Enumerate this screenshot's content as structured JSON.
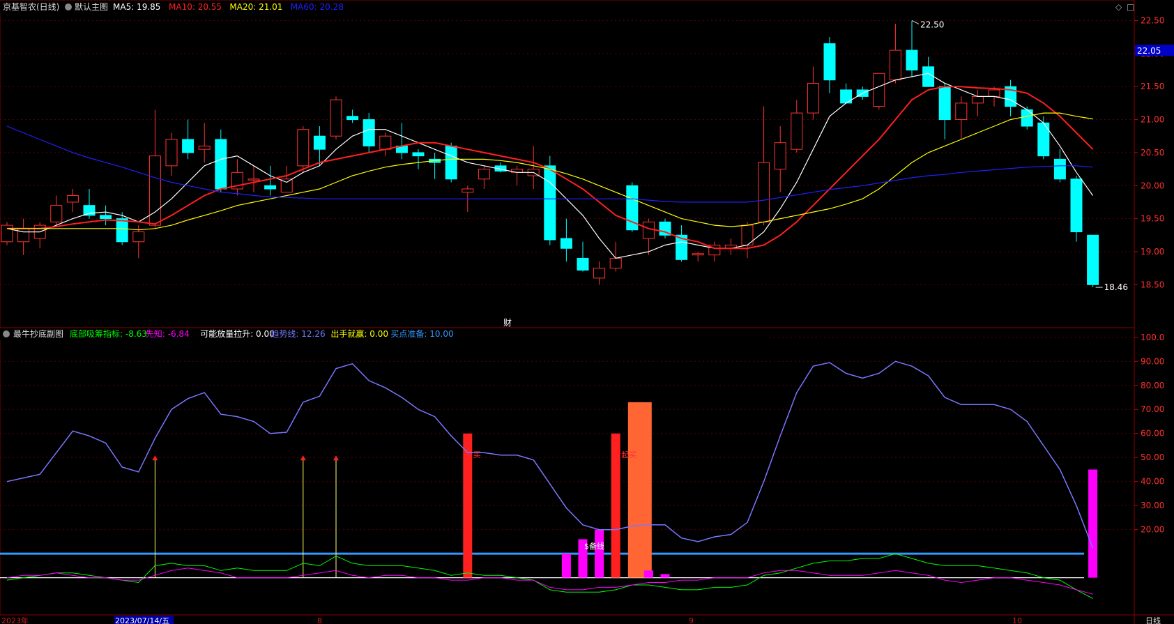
{
  "main_panel": {
    "stock_name": "京基智农",
    "period": "(日线)",
    "template_name": "默认主图",
    "ma_items": [
      {
        "label": "MA5: 19.85",
        "color": "#ffffff"
      },
      {
        "label": "MA10: 20.55",
        "color": "#ff2020"
      },
      {
        "label": "MA20: 21.01",
        "color": "#ffff00"
      },
      {
        "label": "MA60: 20.28",
        "color": "#2020ff"
      }
    ],
    "y_ticks": [
      "22.50",
      "22.00",
      "21.50",
      "21.00",
      "20.50",
      "20.00",
      "19.50",
      "19.00",
      "18.50"
    ],
    "last_price_tag": "22.05",
    "high_marker": "22.50",
    "low_marker": "18.46",
    "finance_marker": "财"
  },
  "sub_panel": {
    "title": "最牛抄底副图",
    "items": [
      {
        "label": "底部吸筹指标: -8.63",
        "color": "#00ff00"
      },
      {
        "label": "先知: -6.84",
        "color": "#ff00ff"
      },
      {
        "label": "可能放量拉升: 0.00",
        "color": "#ffffff"
      },
      {
        "label": "趋势线: 12.26",
        "color": "#7777ff"
      },
      {
        "label": "出手就赢: 0.00",
        "color": "#ffff00"
      },
      {
        "label": "买点准备: 10.00",
        "color": "#3399ff"
      }
    ],
    "y_ticks": [
      "100.0",
      "90.00",
      "80.00",
      "70.00",
      "60.00",
      "50.00",
      "40.00",
      "30.00",
      "20.00"
    ],
    "annotations": [
      "买",
      "起买",
      "$备线"
    ]
  },
  "x_axis": {
    "labels": [
      "2023年",
      "2023/07/14/五",
      "8",
      "9",
      "10"
    ],
    "period_label": "日线"
  },
  "chart_data": [
    {
      "type": "candlestick",
      "title": "京基智农 (日线)",
      "ylim": [
        18.25,
        22.6
      ],
      "candles": [
        {
          "o": 19.15,
          "h": 19.45,
          "l": 19.1,
          "c": 19.4
        },
        {
          "o": 19.15,
          "h": 19.5,
          "l": 18.95,
          "c": 19.35
        },
        {
          "o": 19.2,
          "h": 19.45,
          "l": 19.05,
          "c": 19.4
        },
        {
          "o": 19.45,
          "h": 19.85,
          "l": 19.4,
          "c": 19.7
        },
        {
          "o": 19.75,
          "h": 19.95,
          "l": 19.6,
          "c": 19.85
        },
        {
          "o": 19.7,
          "h": 19.95,
          "l": 19.5,
          "c": 19.55
        },
        {
          "o": 19.55,
          "h": 19.7,
          "l": 19.4,
          "c": 19.5
        },
        {
          "o": 19.5,
          "h": 19.6,
          "l": 19.1,
          "c": 19.15
        },
        {
          "o": 19.15,
          "h": 19.4,
          "l": 18.9,
          "c": 19.3
        },
        {
          "o": 19.4,
          "h": 21.15,
          "l": 19.35,
          "c": 20.45
        },
        {
          "o": 20.3,
          "h": 20.8,
          "l": 20.15,
          "c": 20.7
        },
        {
          "o": 20.7,
          "h": 21.0,
          "l": 20.4,
          "c": 20.5
        },
        {
          "o": 20.55,
          "h": 20.95,
          "l": 20.35,
          "c": 20.6
        },
        {
          "o": 20.7,
          "h": 20.85,
          "l": 19.9,
          "c": 19.95
        },
        {
          "o": 19.95,
          "h": 20.4,
          "l": 19.85,
          "c": 20.2
        },
        {
          "o": 20.1,
          "h": 20.3,
          "l": 19.9,
          "c": 20.1
        },
        {
          "o": 20.0,
          "h": 20.3,
          "l": 19.85,
          "c": 19.95
        },
        {
          "o": 19.9,
          "h": 20.3,
          "l": 19.9,
          "c": 20.1
        },
        {
          "o": 20.3,
          "h": 20.9,
          "l": 20.2,
          "c": 20.85
        },
        {
          "o": 20.75,
          "h": 20.9,
          "l": 20.3,
          "c": 20.55
        },
        {
          "o": 20.75,
          "h": 21.35,
          "l": 20.7,
          "c": 21.3
        },
        {
          "o": 21.05,
          "h": 21.15,
          "l": 20.95,
          "c": 21.0
        },
        {
          "o": 21.0,
          "h": 21.1,
          "l": 20.5,
          "c": 20.6
        },
        {
          "o": 20.55,
          "h": 20.8,
          "l": 20.45,
          "c": 20.75
        },
        {
          "o": 20.6,
          "h": 20.95,
          "l": 20.4,
          "c": 20.5
        },
        {
          "o": 20.5,
          "h": 20.55,
          "l": 20.25,
          "c": 20.45
        },
        {
          "o": 20.4,
          "h": 20.5,
          "l": 20.1,
          "c": 20.35
        },
        {
          "o": 20.6,
          "h": 20.65,
          "l": 20.05,
          "c": 20.1
        },
        {
          "o": 19.9,
          "h": 20.0,
          "l": 19.6,
          "c": 19.95
        },
        {
          "o": 20.1,
          "h": 20.3,
          "l": 19.95,
          "c": 20.25
        },
        {
          "o": 20.3,
          "h": 20.35,
          "l": 20.2,
          "c": 20.22
        },
        {
          "o": 20.2,
          "h": 20.3,
          "l": 20.0,
          "c": 20.25
        },
        {
          "o": 20.15,
          "h": 20.6,
          "l": 19.95,
          "c": 20.25
        },
        {
          "o": 20.3,
          "h": 20.45,
          "l": 19.1,
          "c": 19.18
        },
        {
          "o": 19.2,
          "h": 19.5,
          "l": 18.85,
          "c": 19.05
        },
        {
          "o": 18.9,
          "h": 19.15,
          "l": 18.7,
          "c": 18.72
        },
        {
          "o": 18.6,
          "h": 18.85,
          "l": 18.5,
          "c": 18.75
        },
        {
          "o": 18.75,
          "h": 19.15,
          "l": 18.7,
          "c": 18.9
        },
        {
          "o": 20.0,
          "h": 20.05,
          "l": 19.3,
          "c": 19.33
        },
        {
          "o": 19.2,
          "h": 19.5,
          "l": 18.95,
          "c": 19.45
        },
        {
          "o": 19.45,
          "h": 19.5,
          "l": 19.2,
          "c": 19.25
        },
        {
          "o": 19.25,
          "h": 19.4,
          "l": 18.85,
          "c": 18.88
        },
        {
          "o": 18.95,
          "h": 19.0,
          "l": 18.85,
          "c": 18.97
        },
        {
          "o": 18.95,
          "h": 19.15,
          "l": 18.85,
          "c": 19.1
        },
        {
          "o": 19.05,
          "h": 19.2,
          "l": 18.95,
          "c": 19.1
        },
        {
          "o": 19.1,
          "h": 19.45,
          "l": 18.9,
          "c": 19.4
        },
        {
          "o": 19.45,
          "h": 21.2,
          "l": 19.4,
          "c": 20.35
        },
        {
          "o": 20.25,
          "h": 20.9,
          "l": 19.9,
          "c": 20.65
        },
        {
          "o": 20.55,
          "h": 21.3,
          "l": 20.5,
          "c": 21.1
        },
        {
          "o": 21.1,
          "h": 21.8,
          "l": 21.0,
          "c": 21.55
        },
        {
          "o": 22.15,
          "h": 22.25,
          "l": 21.4,
          "c": 21.6
        },
        {
          "o": 21.45,
          "h": 21.55,
          "l": 21.25,
          "c": 21.25
        },
        {
          "o": 21.45,
          "h": 21.5,
          "l": 21.3,
          "c": 21.35
        },
        {
          "o": 21.2,
          "h": 21.65,
          "l": 21.15,
          "c": 21.7
        },
        {
          "o": 21.6,
          "h": 22.45,
          "l": 21.55,
          "c": 22.05
        },
        {
          "o": 22.05,
          "h": 22.5,
          "l": 21.65,
          "c": 21.75
        },
        {
          "o": 21.8,
          "h": 21.95,
          "l": 21.5,
          "c": 21.5
        },
        {
          "o": 21.5,
          "h": 21.55,
          "l": 20.7,
          "c": 21.0
        },
        {
          "o": 21.0,
          "h": 21.35,
          "l": 20.7,
          "c": 21.25
        },
        {
          "o": 21.25,
          "h": 21.45,
          "l": 21.05,
          "c": 21.35
        },
        {
          "o": 21.35,
          "h": 21.5,
          "l": 21.2,
          "c": 21.45
        },
        {
          "o": 21.5,
          "h": 21.6,
          "l": 21.05,
          "c": 21.2
        },
        {
          "o": 21.15,
          "h": 21.2,
          "l": 20.85,
          "c": 20.9
        },
        {
          "o": 20.95,
          "h": 21.05,
          "l": 20.4,
          "c": 20.45
        },
        {
          "o": 20.4,
          "h": 20.55,
          "l": 20.05,
          "c": 20.1
        },
        {
          "o": 20.1,
          "h": 20.15,
          "l": 19.15,
          "c": 19.3
        },
        {
          "o": 19.25,
          "h": 19.25,
          "l": 18.46,
          "c": 18.5
        }
      ],
      "series": [
        {
          "name": "MA5",
          "color": "#ffffff",
          "values": [
            19.35,
            19.3,
            19.3,
            19.4,
            19.5,
            19.58,
            19.6,
            19.55,
            19.45,
            19.6,
            19.8,
            20.05,
            20.3,
            20.4,
            20.45,
            20.3,
            20.15,
            20.05,
            20.2,
            20.3,
            20.55,
            20.75,
            20.85,
            20.85,
            20.75,
            20.65,
            20.55,
            20.45,
            20.35,
            20.3,
            20.25,
            20.2,
            20.2,
            20.05,
            19.8,
            19.55,
            19.2,
            18.9,
            18.95,
            19.0,
            19.1,
            19.15,
            19.1,
            19.05,
            19.05,
            19.1,
            19.3,
            19.65,
            20.05,
            20.55,
            21.05,
            21.25,
            21.4,
            21.5,
            21.6,
            21.65,
            21.7,
            21.55,
            21.45,
            21.35,
            21.35,
            21.3,
            21.15,
            20.95,
            20.6,
            20.2,
            19.85
          ]
        },
        {
          "name": "MA10",
          "color": "#ff2020",
          "values": [
            19.35,
            19.35,
            19.35,
            19.38,
            19.42,
            19.45,
            19.48,
            19.47,
            19.45,
            19.42,
            19.55,
            19.7,
            19.85,
            19.95,
            20.0,
            20.05,
            20.1,
            20.15,
            20.25,
            20.35,
            20.4,
            20.45,
            20.5,
            20.55,
            20.6,
            20.65,
            20.65,
            20.6,
            20.55,
            20.5,
            20.45,
            20.4,
            20.35,
            20.25,
            20.1,
            19.95,
            19.75,
            19.55,
            19.45,
            19.35,
            19.3,
            19.2,
            19.15,
            19.05,
            19.05,
            19.05,
            19.1,
            19.25,
            19.45,
            19.7,
            19.95,
            20.2,
            20.45,
            20.7,
            21.0,
            21.3,
            21.45,
            21.5,
            21.5,
            21.48,
            21.47,
            21.45,
            21.4,
            21.25,
            21.05,
            20.8,
            20.55
          ]
        },
        {
          "name": "MA20",
          "color": "#ffff00",
          "values": [
            19.35,
            19.35,
            19.35,
            19.35,
            19.35,
            19.35,
            19.35,
            19.35,
            19.33,
            19.35,
            19.4,
            19.48,
            19.55,
            19.62,
            19.7,
            19.75,
            19.8,
            19.85,
            19.9,
            19.95,
            20.05,
            20.15,
            20.22,
            20.28,
            20.32,
            20.35,
            20.38,
            20.4,
            20.4,
            20.4,
            20.38,
            20.35,
            20.3,
            20.25,
            20.18,
            20.1,
            20.0,
            19.9,
            19.8,
            19.7,
            19.6,
            19.5,
            19.45,
            19.4,
            19.38,
            19.4,
            19.45,
            19.5,
            19.55,
            19.6,
            19.65,
            19.72,
            19.8,
            19.95,
            20.15,
            20.35,
            20.5,
            20.6,
            20.7,
            20.8,
            20.9,
            21.0,
            21.05,
            21.1,
            21.1,
            21.05,
            21.01
          ]
        },
        {
          "name": "MA60",
          "color": "#2020ff",
          "values": [
            20.9,
            20.8,
            20.7,
            20.6,
            20.5,
            20.42,
            20.35,
            20.28,
            20.2,
            20.12,
            20.05,
            20.0,
            19.95,
            19.9,
            19.88,
            19.85,
            19.83,
            19.82,
            19.81,
            19.8,
            19.8,
            19.8,
            19.8,
            19.8,
            19.8,
            19.8,
            19.8,
            19.8,
            19.8,
            19.8,
            19.8,
            19.8,
            19.8,
            19.8,
            19.8,
            19.8,
            19.8,
            19.8,
            19.8,
            19.78,
            19.76,
            19.75,
            19.75,
            19.75,
            19.75,
            19.75,
            19.78,
            19.82,
            19.86,
            19.9,
            19.94,
            19.97,
            20.0,
            20.04,
            20.08,
            20.12,
            20.15,
            20.17,
            20.2,
            20.22,
            20.24,
            20.26,
            20.28,
            20.29,
            20.3,
            20.3,
            20.28
          ]
        }
      ]
    },
    {
      "type": "line",
      "title": "最牛抄底副图",
      "ylim": [
        -12,
        104
      ],
      "series": [
        {
          "name": "趋势线",
          "color": "#7777ff",
          "values": [
            40,
            41.5,
            43,
            52,
            61,
            59,
            56,
            46,
            44,
            58,
            70,
            74.5,
            77,
            68,
            67,
            65,
            60,
            60.5,
            73,
            75.5,
            87,
            89,
            82,
            79,
            75,
            70,
            67,
            59,
            52,
            52,
            51,
            51,
            49,
            39,
            29,
            22,
            20,
            20,
            21.5,
            22,
            22,
            16.5,
            15,
            17,
            18,
            23,
            40,
            59,
            77,
            88,
            89.5,
            85,
            83,
            85,
            90,
            88,
            84,
            75,
            72,
            72,
            72,
            70,
            65,
            55,
            45,
            30,
            12.26
          ]
        },
        {
          "name": "底部吸筹指标",
          "color": "#00ff00",
          "values": [
            -1,
            0,
            1,
            2,
            2,
            1,
            0,
            -1,
            -2,
            5,
            6,
            5,
            5,
            3,
            4,
            3,
            3,
            3,
            6,
            5,
            9,
            6,
            5,
            5,
            5,
            4,
            3,
            1,
            2,
            1,
            1,
            0,
            -1,
            -5,
            -6,
            -6,
            -6,
            -5,
            -3,
            -3,
            -4,
            -5,
            -5,
            -4,
            -4,
            -3,
            1,
            2,
            4,
            6,
            7,
            7,
            8,
            8,
            10,
            8,
            6,
            5,
            5,
            5,
            4,
            3,
            2,
            0,
            -1,
            -5,
            -8.63
          ]
        },
        {
          "name": "先知",
          "color": "#ff00ff",
          "values": [
            0,
            1,
            1,
            2,
            1,
            0,
            0,
            -1,
            -1,
            1,
            3,
            4,
            3,
            2,
            0,
            0,
            0,
            0,
            1,
            2,
            3,
            1,
            0,
            1,
            1,
            0,
            0,
            -1,
            -1,
            0,
            0,
            -1,
            -1,
            -4,
            -5,
            -5,
            -4,
            -4,
            -3,
            -2,
            -2,
            -1,
            -1,
            0,
            0,
            0,
            2,
            3,
            3,
            2,
            1,
            1,
            1,
            2,
            3,
            2,
            1,
            -1,
            -2,
            -1,
            0,
            0,
            -1,
            -2,
            -3,
            -5,
            -6.84
          ]
        },
        {
          "name": "买点准备",
          "color": "#3399ff",
          "values": [
            10
          ]
        }
      ],
      "bars": [
        {
          "i": 9,
          "kind": "stem",
          "value": 50,
          "color": "#ffff66"
        },
        {
          "i": 18,
          "kind": "stem",
          "value": 50,
          "color": "#ffff66"
        },
        {
          "i": 20,
          "kind": "stem",
          "value": 50,
          "color": "#ffff66"
        },
        {
          "i": 28,
          "kind": "bar",
          "value": 60,
          "color": "#ff2020"
        },
        {
          "i": 34,
          "kind": "bar",
          "value": 10,
          "color": "#ff00ff"
        },
        {
          "i": 35,
          "kind": "bar",
          "value": 16,
          "color": "#ff00ff"
        },
        {
          "i": 36,
          "kind": "bar",
          "value": 20,
          "color": "#ff00ff"
        },
        {
          "i": 37,
          "kind": "bar",
          "value": 60,
          "color": "#ff2020"
        },
        {
          "i": 38,
          "kind": "widebar",
          "value": 73,
          "color": "#ff6633"
        },
        {
          "i": 39,
          "kind": "bar",
          "value": 3,
          "color": "#ff00ff"
        },
        {
          "i": 40,
          "kind": "bar",
          "value": 1.5,
          "color": "#ff00ff"
        },
        {
          "i": 66,
          "kind": "bar",
          "value": 45,
          "color": "#ff00ff"
        }
      ]
    }
  ]
}
